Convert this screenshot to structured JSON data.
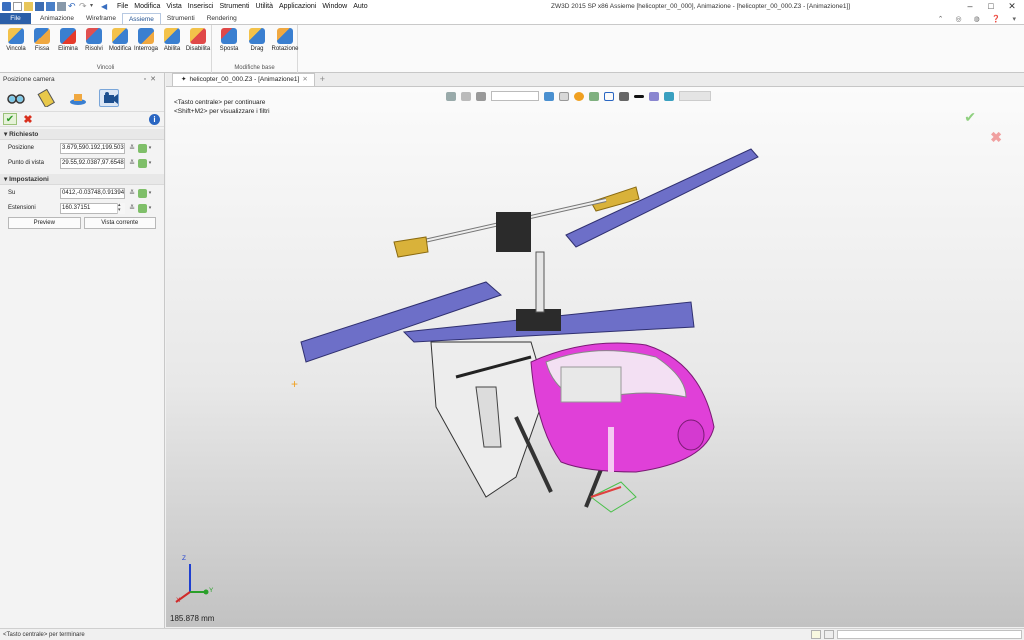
{
  "menu": [
    "File",
    "Modifica",
    "Vista",
    "Inserisci",
    "Strumenti",
    "Utilità",
    "Applicazioni",
    "Window",
    "Auto"
  ],
  "title": "ZW3D 2015 SP x86        Assieme [helicopter_00_000],  Animazione - [helicopter_00_000.Z3 - [Animazione1]]",
  "ribbon_tabs": [
    "File",
    "Animazione",
    "Wireframe",
    "Assieme",
    "Strumenti",
    "Rendering"
  ],
  "ribbon_active": "Assieme",
  "groups": {
    "vincoli": {
      "label": "Vincoli",
      "buttons": [
        "Vincola",
        "Fissa",
        "Elimina",
        "Risolvi",
        "Modifica",
        "Interroga",
        "Abilita",
        "Disabilita"
      ]
    },
    "modifiche": {
      "label": "Modifiche base",
      "buttons": [
        "Sposta",
        "Drag",
        "Rotazione"
      ]
    }
  },
  "panel": {
    "title": "Posizione camera",
    "richiesto": {
      "title": "Richiesto",
      "posizione_label": "Posizione",
      "posizione_value": "3.679,590.192,199.503",
      "punto_label": "Punto di vista",
      "punto_value": "29.55,92.0387,97.6548"
    },
    "impostazioni": {
      "title": "Impostazioni",
      "su_label": "Su",
      "su_value": "0412,-0.03748,0.91394",
      "estensioni_label": "Estensioni",
      "estensioni_value": "160.37151"
    },
    "preview_button": "Preview",
    "vista_corrente_button": "Vista corrente"
  },
  "doc_tab": "helicopter_00_000.Z3 - [Animazione1]",
  "viewport": {
    "hint1": "<Tasto centrale> per continuare",
    "hint2": "<Shift+M2> per visualizzare i filtri",
    "distance": "185.878 mm",
    "axis_x": "X",
    "axis_y": "Y",
    "axis_z": "Z"
  },
  "status": "<Tasto centrale> per terminare",
  "colors": {
    "file_tab": "#2b5fa8",
    "blade": "#6d6fc8",
    "canopy": "#e040d8",
    "tip": "#d9b23a"
  }
}
